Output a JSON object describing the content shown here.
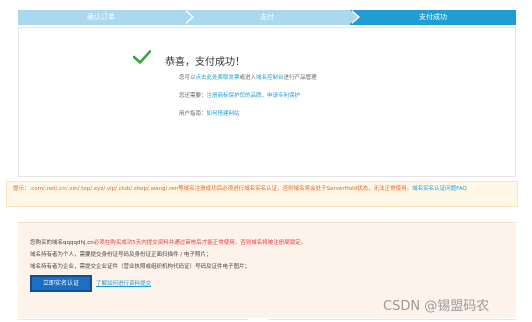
{
  "steps": [
    {
      "label": "确认订单"
    },
    {
      "label": "支付"
    },
    {
      "label": "支付成功"
    }
  ],
  "success": {
    "title": "恭喜，支付成功！",
    "line1_pre": "您可以",
    "line1_link1": "点击此处索取发票",
    "line1_mid": "或进入",
    "line1_link2": "域名控制台",
    "line1_post": "进行产品管理",
    "line2_pre": "您还需要：",
    "line2_link1": "注册商标保护您的品牌，",
    "line2_link2": "申请专利保护",
    "line3_pre": "用户指南：",
    "line3_link": "如何搭建网站"
  },
  "notice": {
    "text": "提示：.com/.net/.cn/.xin/.top/.xyz/.vip/.club/.shop/.wang/.ren等域名注册成功后必须进行域名实名认证，否则域名将会处于ServerHold状态，无法正常使用。",
    "link": "域名实名认证问题FAQ"
  },
  "verify": {
    "line1_pre": "您购买的域名qqqqdhj.cn",
    "line1_red": "必须在购买成功5天内提交资料并通过审核后才能正常使用，否则域名将被注册局锁定。",
    "line2": "域名持有者为个人，需要提交身份证号码及身份证正面扫描件 / 电子照片；",
    "line3": "域名持有者为企业，需提交企业证件（营业执照或组织机构代码证）号码及证件电子图片；",
    "button": "立即实名认证",
    "link": "了解如何进行资料提交"
  },
  "watermark": "CSDN @锡盟码农",
  "colors": {
    "accent": "#1f9ed4",
    "step_done": "#a9d8ef",
    "button": "#1b6ec2",
    "notice": "#e5632b",
    "success_check": "#3ca63c"
  }
}
